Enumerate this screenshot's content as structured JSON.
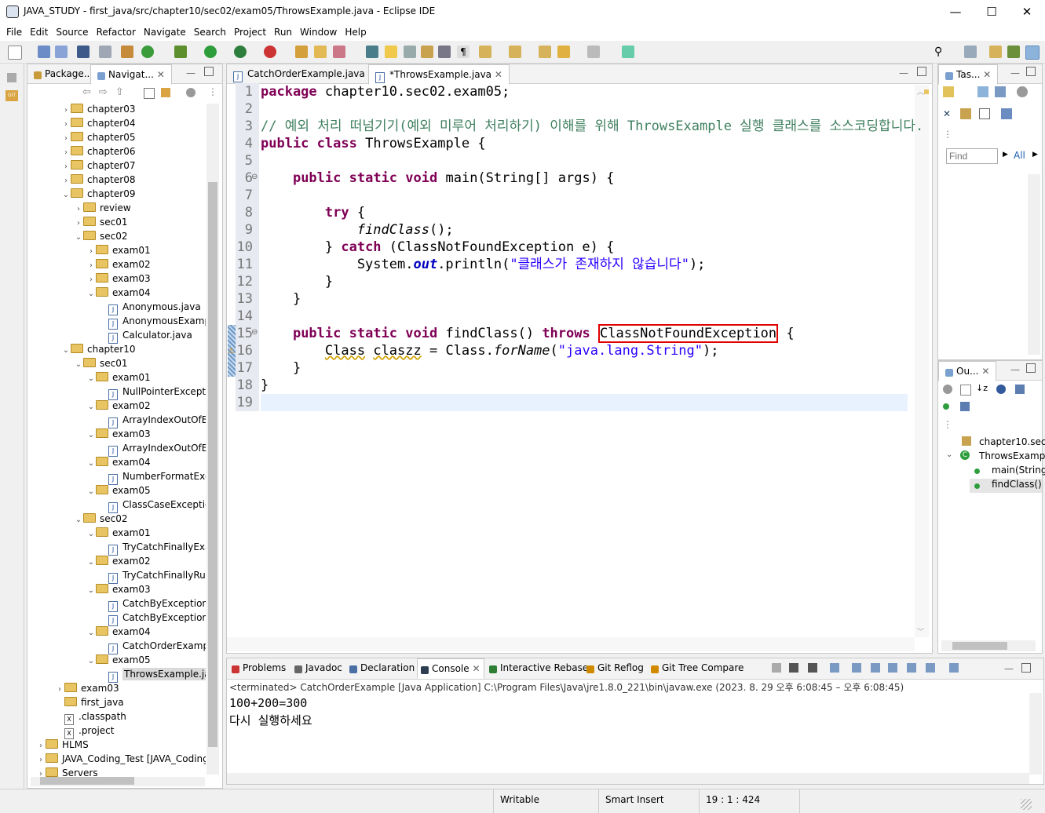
{
  "window": {
    "title": "JAVA_STUDY - first_java/src/chapter10/sec02/exam05/ThrowsExample.java - Eclipse IDE",
    "minimize": "—",
    "maximize": "☐",
    "close": "✕"
  },
  "menu": [
    "File",
    "Edit",
    "Source",
    "Refactor",
    "Navigate",
    "Search",
    "Project",
    "Run",
    "Window",
    "Help"
  ],
  "left_tabs": {
    "package": "Package...",
    "navigator": "Navigat..."
  },
  "tree": [
    {
      "label": "chapter03",
      "type": "folder",
      "depth": 3,
      "arrow": "›"
    },
    {
      "label": "chapter04",
      "type": "folder",
      "depth": 3,
      "arrow": "›"
    },
    {
      "label": "chapter05",
      "type": "folder",
      "depth": 3,
      "arrow": "›"
    },
    {
      "label": "chapter06",
      "type": "folder",
      "depth": 3,
      "arrow": "›"
    },
    {
      "label": "chapter07",
      "type": "folder",
      "depth": 3,
      "arrow": "›"
    },
    {
      "label": "chapter08",
      "type": "folder",
      "depth": 3,
      "arrow": "›"
    },
    {
      "label": "chapter09",
      "type": "folder",
      "depth": 3,
      "arrow": "⌄"
    },
    {
      "label": "review",
      "type": "folder",
      "depth": 4,
      "arrow": "›"
    },
    {
      "label": "sec01",
      "type": "folder",
      "depth": 4,
      "arrow": "›"
    },
    {
      "label": "sec02",
      "type": "folder",
      "depth": 4,
      "arrow": "⌄"
    },
    {
      "label": "exam01",
      "type": "folder",
      "depth": 5,
      "arrow": "›"
    },
    {
      "label": "exam02",
      "type": "folder",
      "depth": 5,
      "arrow": "›"
    },
    {
      "label": "exam03",
      "type": "folder",
      "depth": 5,
      "arrow": "›"
    },
    {
      "label": "exam04",
      "type": "folder",
      "depth": 5,
      "arrow": "⌄"
    },
    {
      "label": "Anonymous.java",
      "type": "java",
      "depth": 6,
      "arrow": ""
    },
    {
      "label": "AnonymousExample",
      "type": "java",
      "depth": 6,
      "arrow": ""
    },
    {
      "label": "Calculator.java",
      "type": "java",
      "depth": 6,
      "arrow": ""
    },
    {
      "label": "chapter10",
      "type": "folder",
      "depth": 3,
      "arrow": "⌄"
    },
    {
      "label": "sec01",
      "type": "folder",
      "depth": 4,
      "arrow": "⌄"
    },
    {
      "label": "exam01",
      "type": "folder",
      "depth": 5,
      "arrow": "⌄"
    },
    {
      "label": "NullPointerExceptio",
      "type": "java",
      "depth": 6,
      "arrow": ""
    },
    {
      "label": "exam02",
      "type": "folder",
      "depth": 5,
      "arrow": "⌄"
    },
    {
      "label": "ArrayIndexOutOfBo",
      "type": "java",
      "depth": 6,
      "arrow": ""
    },
    {
      "label": "exam03",
      "type": "folder",
      "depth": 5,
      "arrow": "⌄"
    },
    {
      "label": "ArrayIndexOutOfBo",
      "type": "java",
      "depth": 6,
      "arrow": ""
    },
    {
      "label": "exam04",
      "type": "folder",
      "depth": 5,
      "arrow": "⌄"
    },
    {
      "label": "NumberFormatExce",
      "type": "java",
      "depth": 6,
      "arrow": ""
    },
    {
      "label": "exam05",
      "type": "folder",
      "depth": 5,
      "arrow": "⌄"
    },
    {
      "label": "ClassCaseException",
      "type": "java",
      "depth": 6,
      "arrow": ""
    },
    {
      "label": "sec02",
      "type": "folder",
      "depth": 4,
      "arrow": "⌄"
    },
    {
      "label": "exam01",
      "type": "folder",
      "depth": 5,
      "arrow": "⌄"
    },
    {
      "label": "TryCatchFinallyExan",
      "type": "java",
      "depth": 6,
      "arrow": ""
    },
    {
      "label": "exam02",
      "type": "folder",
      "depth": 5,
      "arrow": "⌄"
    },
    {
      "label": "TryCatchFinallyRunt",
      "type": "java",
      "depth": 6,
      "arrow": ""
    },
    {
      "label": "exam03",
      "type": "folder",
      "depth": 5,
      "arrow": "⌄"
    },
    {
      "label": "CatchByExceptionKi",
      "type": "java",
      "depth": 6,
      "arrow": ""
    },
    {
      "label": "CatchByExceptionKi",
      "type": "java",
      "depth": 6,
      "arrow": ""
    },
    {
      "label": "exam04",
      "type": "folder",
      "depth": 5,
      "arrow": "⌄"
    },
    {
      "label": "CatchOrderExample",
      "type": "java",
      "depth": 6,
      "arrow": ""
    },
    {
      "label": "exam05",
      "type": "folder",
      "depth": 5,
      "arrow": "⌄"
    },
    {
      "label": "ThrowsExample.java",
      "type": "java",
      "depth": 6,
      "arrow": "",
      "selected": true
    },
    {
      "label": "exam03",
      "type": "folder",
      "depth": 2,
      "arrow": "›"
    },
    {
      "label": "first_java",
      "type": "folder",
      "depth": 2,
      "arrow": ""
    },
    {
      "label": ".classpath",
      "type": "xml",
      "depth": 2,
      "arrow": ""
    },
    {
      "label": ".project",
      "type": "xml",
      "depth": 2,
      "arrow": ""
    },
    {
      "label": "HLMS",
      "type": "folder",
      "depth": 0,
      "arrow": "›"
    },
    {
      "label": "JAVA_Coding_Test [JAVA_Coding_T",
      "type": "folder",
      "depth": 0,
      "arrow": "›"
    },
    {
      "label": "Servers",
      "type": "folder",
      "depth": 0,
      "arrow": "›"
    }
  ],
  "editor_tabs": [
    {
      "label": "CatchOrderExample.java",
      "active": false
    },
    {
      "label": "*ThrowsExample.java",
      "active": true,
      "close": "✕"
    }
  ],
  "code_lines": [
    "package chapter10.sec02.exam05;",
    "",
    "// 예외 처리 떠넘기기(예외 미루어 처리하기) 이해를 위해 ThrowsExample 실행 클래스를 소스코딩합니다.",
    "public class ThrowsExample {",
    "",
    "    public static void main(String[] args) {",
    "",
    "        try {",
    "            findClass();",
    "        } catch (ClassNotFoundException e) {",
    "            System.out.println(\"클래스가 존재하지 않습니다\");",
    "        }",
    "    }",
    "",
    "    public static void findClass() throws ClassNotFoundException {",
    "        Class claszz = Class.forName(\"java.lang.String\");",
    "    }",
    "}",
    ""
  ],
  "tasks_panel": {
    "tab": "Tas...",
    "find_placeholder": "Find",
    "all": "All"
  },
  "outline_panel": {
    "tab": "Ou...",
    "items": [
      "chapter10.sec0",
      "ThrowsExample",
      "main(String",
      "findClass() :"
    ]
  },
  "bottom_tabs": [
    "Problems",
    "Javadoc",
    "Declaration",
    "Console",
    "Interactive Rebase",
    "Git Reflog",
    "Git Tree Compare"
  ],
  "console": {
    "header": "<terminated> CatchOrderExample [Java Application] C:\\Program Files\\Java\\jre1.8.0_221\\bin\\javaw.exe  (2023. 8. 29 오후 6:08:45 – 오후 6:08:45)",
    "lines": [
      "100+200=300",
      "다시 실행하세요"
    ]
  },
  "status": {
    "writable": "Writable",
    "insert": "Smart Insert",
    "position": "19 : 1 : 424"
  }
}
